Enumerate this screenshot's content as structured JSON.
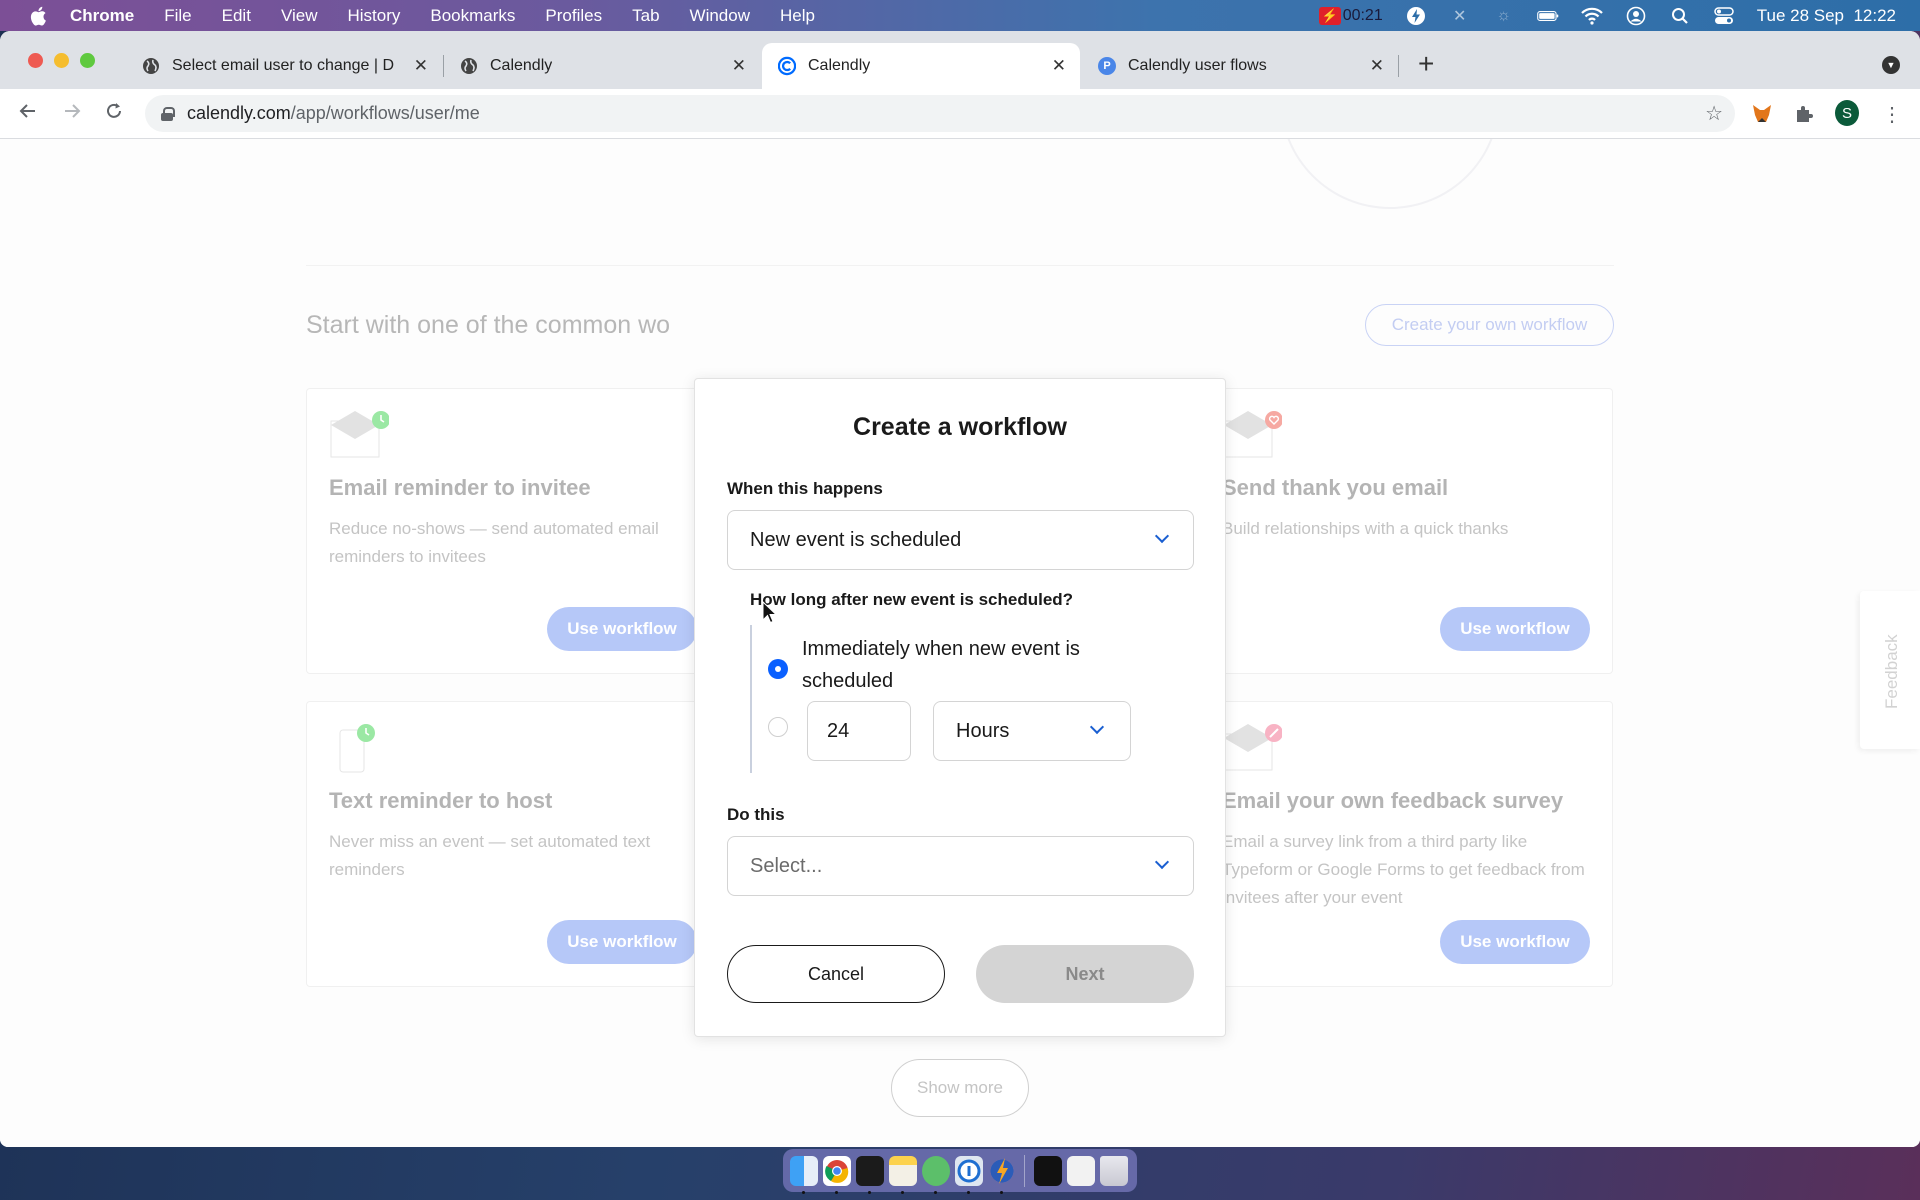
{
  "menubar": {
    "app": "Chrome",
    "items": [
      "File",
      "Edit",
      "View",
      "History",
      "Bookmarks",
      "Profiles",
      "Tab",
      "Window",
      "Help"
    ],
    "recording_time": "00:21",
    "datetime": "Tue 28 Sep  12:22"
  },
  "browser": {
    "tabs": [
      {
        "title": "Select email user to change | D",
        "icon": "globe-icon",
        "active": false
      },
      {
        "title": "Calendly",
        "icon": "globe-icon",
        "active": false
      },
      {
        "title": "Calendly",
        "icon": "calendly-icon",
        "active": true
      },
      {
        "title": "Calendly user flows",
        "icon": "p-icon",
        "active": false
      }
    ],
    "url_domain": "calendly.com",
    "url_path": "/app/workflows/user/me",
    "profile_initial": "S"
  },
  "page": {
    "section_title": "Start with one of the common wo",
    "create_own_label": "Create your own workflow",
    "cards": [
      {
        "title": "Email reminder to invitee",
        "desc": "Reduce no-shows — send automated email reminders to invitees",
        "button": "Use workflow",
        "icon": "envelope-clock-icon",
        "badge_color": "#8fe39a"
      },
      {
        "title": "Send thank you email",
        "desc": "Build relationships with a quick thanks",
        "button": "Use workflow",
        "icon": "envelope-heart-icon",
        "badge_color": "#f4a09a"
      },
      {
        "title": "Text reminder to host",
        "desc": "Never miss an event — set automated text reminders",
        "button": "Use workflow",
        "icon": "phone-clock-icon",
        "badge_color": "#8fe39a"
      },
      {
        "title": "",
        "desc": "",
        "button": "Use workflow",
        "icon": "",
        "badge_color": ""
      },
      {
        "title": "Email your own feedback survey",
        "desc": "Email a survey link from a third party like Typeform or Google Forms to get feedback from invitees after your event",
        "button": "Use workflow",
        "icon": "envelope-pencil-icon",
        "badge_color": "#f7a7bb"
      }
    ],
    "show_more_label": "Show more",
    "feedback_label": "Feedback"
  },
  "modal": {
    "title": "Create a workflow",
    "trigger_label": "When this happens",
    "trigger_value": "New event is scheduled",
    "timing_label": "How long after new event is scheduled?",
    "timing_options": [
      {
        "label": "Immediately when new event is scheduled",
        "checked": true
      },
      {
        "label": "",
        "checked": false
      }
    ],
    "delay_amount": "24",
    "delay_unit": "Hours",
    "action_label": "Do this",
    "action_placeholder": "Select...",
    "cancel_label": "Cancel",
    "next_label": "Next",
    "accent_color": "#0a60ff"
  },
  "dock": {
    "apps": [
      "Finder",
      "Chrome",
      "Terminal",
      "Notes",
      "Atom",
      "1Password",
      "Reeder",
      "Screen recorder",
      "Preview",
      "Trash"
    ]
  }
}
